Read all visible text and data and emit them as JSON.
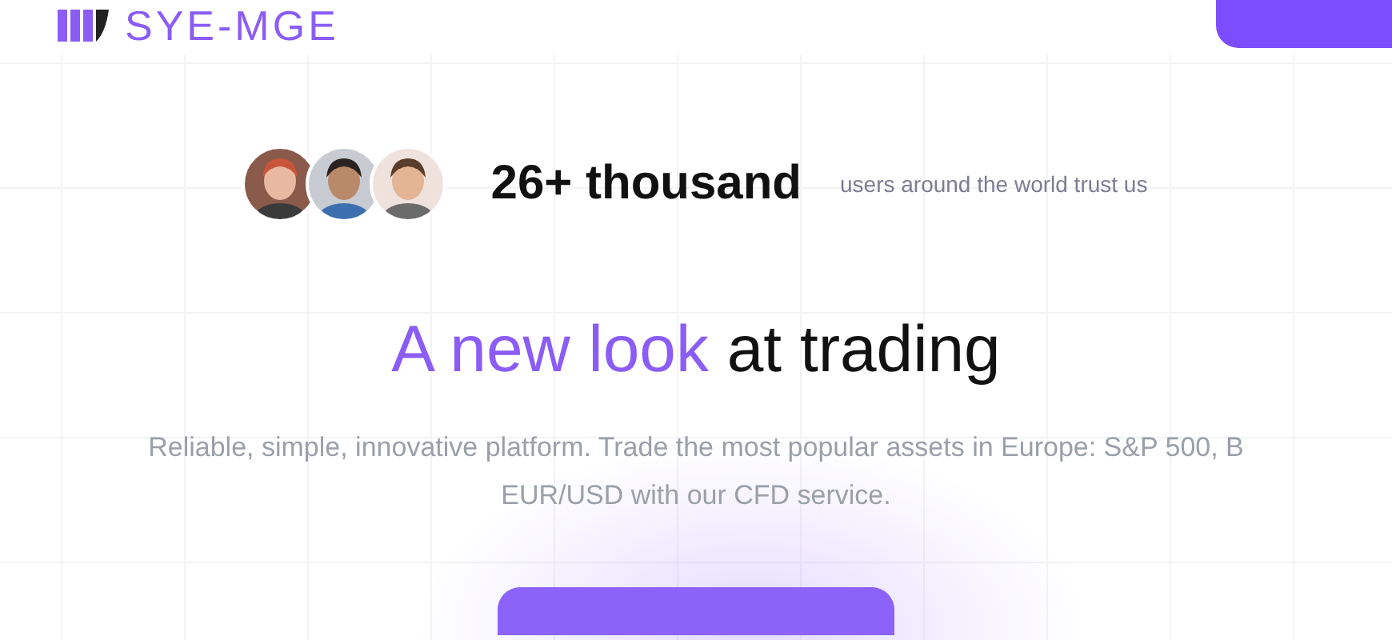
{
  "header": {
    "logo_text": "SYE-MGE"
  },
  "hero": {
    "avatars": [
      {
        "kind": "picture"
      },
      {
        "kind": "picture"
      },
      {
        "kind": "picture"
      }
    ],
    "count": "26+ thousand",
    "count_caption": "users around the world trust us",
    "title_highlight": "A new look",
    "title_rest": "at trading",
    "description_lines": [
      "Reliable, simple, innovative platform. Trade the most popular assets in Europe: S&P 500, B",
      "EUR/USD with our CFD service."
    ]
  }
}
